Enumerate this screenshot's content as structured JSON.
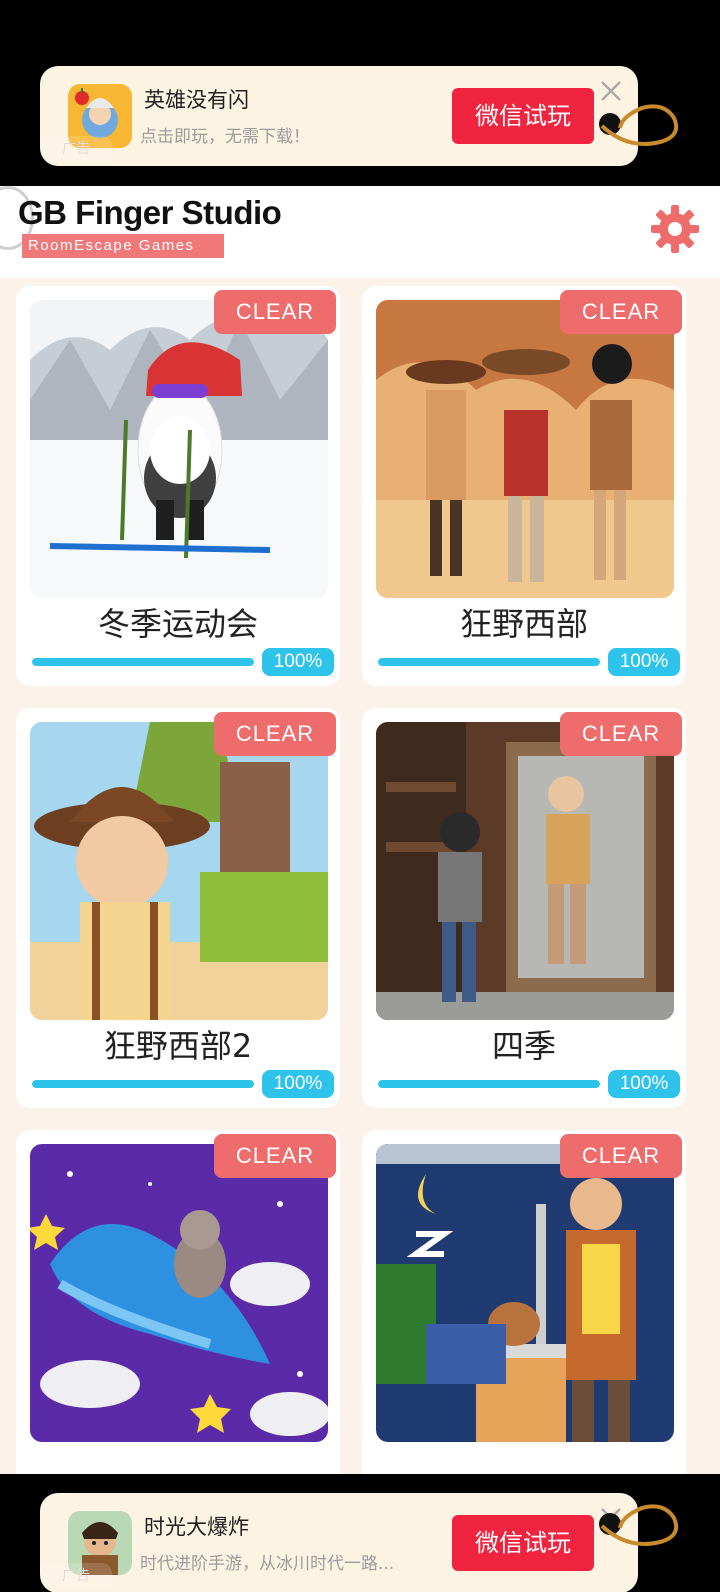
{
  "ads": {
    "top": {
      "title": "英雄没有闪",
      "subtitle": "点击即玩，无需下载！",
      "cta": "微信试玩",
      "tag": "广告"
    },
    "bottom": {
      "title": "时光大爆炸",
      "subtitle": "时代进阶手游，从冰川时代一路...",
      "cta": "微信试玩",
      "tag": "广告"
    }
  },
  "header": {
    "brand": "GB Finger Studio",
    "tagline": "RoomEscape  Games"
  },
  "games": [
    {
      "title": "冬季运动会",
      "badge": "CLEAR",
      "progress_label": "100%",
      "progress": 1.0,
      "thumb_icon": "panda-skier-image"
    },
    {
      "title": "狂野西部",
      "badge": "CLEAR",
      "progress_label": "100%",
      "progress": 1.0,
      "thumb_icon": "cowboys-desert-image"
    },
    {
      "title": "狂野西部2",
      "badge": "CLEAR",
      "progress_label": "100%",
      "progress": 1.0,
      "thumb_icon": "cowboy-farm-image"
    },
    {
      "title": "四季",
      "badge": "CLEAR",
      "progress_label": "100%",
      "progress": 1.0,
      "thumb_icon": "mirror-room-image"
    },
    {
      "badge": "CLEAR",
      "thumb_icon": "whale-cat-space-image"
    },
    {
      "badge": "CLEAR",
      "thumb_icon": "office-sleeping-image"
    }
  ],
  "colors": {
    "accent_red": "#ef6c6c",
    "progress_blue": "#2ec3ea",
    "cta_red": "#f0243f",
    "page_bg": "#fbf3ea"
  }
}
